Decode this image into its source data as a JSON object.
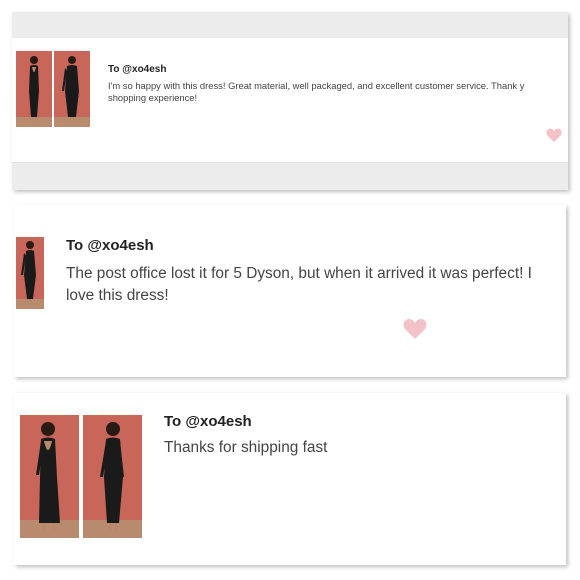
{
  "colors": {
    "photo_background": "#c8665a",
    "photo_floor": "#b88a6e",
    "dress": "#1a1a1a",
    "skin": "#b9876a",
    "heart": "#f3c2c8",
    "text_primary": "#222222",
    "text_body": "#444444"
  },
  "reviews": [
    {
      "to": "To @xo4esh",
      "message_line1": "I'm so happy with this dress! Great material, well packaged, and excellent customer service. Thank y",
      "message_line2": "shopping experience!",
      "photos": [
        "dress-back-view-photo",
        "dress-front-view-photo"
      ],
      "heart_icon": "heart-icon"
    },
    {
      "to": "To @xo4esh",
      "message_line1": "The post office lost it for 5 Dyson, but when it arrived it was perfect! I",
      "message_line2": "love this dress!",
      "photos": [
        "dress-front-view-photo"
      ],
      "heart_icon": "heart-icon"
    },
    {
      "to": "To @xo4esh",
      "message_line1": "Thanks for shipping fast",
      "photos": [
        "dress-back-view-photo",
        "dress-front-view-photo"
      ]
    }
  ]
}
